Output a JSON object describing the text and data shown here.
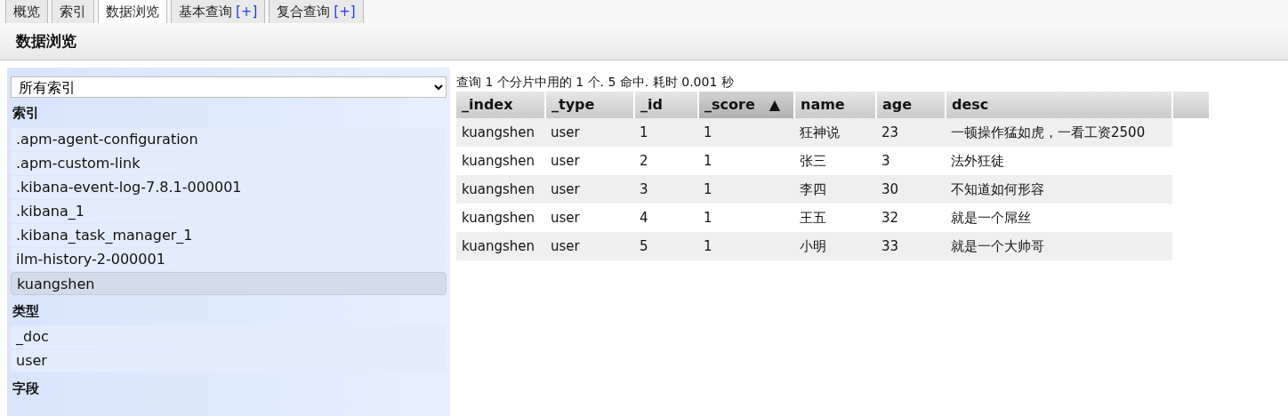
{
  "tabs": [
    {
      "label": "概览",
      "selected": false
    },
    {
      "label": "索引",
      "selected": false
    },
    {
      "label": "数据浏览",
      "selected": true
    },
    {
      "label": "基本查询",
      "plus": "[+]",
      "selected": false
    },
    {
      "label": "复合查询",
      "plus": "[+]",
      "selected": false
    }
  ],
  "page_title": "数据浏览",
  "sidebar": {
    "index_select": {
      "value": "所有索引"
    },
    "sections": [
      {
        "heading": "索引",
        "items": [
          {
            "label": ".apm-agent-configuration",
            "selected": false
          },
          {
            "label": ".apm-custom-link",
            "selected": false
          },
          {
            "label": ".kibana-event-log-7.8.1-000001",
            "selected": false
          },
          {
            "label": ".kibana_1",
            "selected": false
          },
          {
            "label": ".kibana_task_manager_1",
            "selected": false
          },
          {
            "label": "ilm-history-2-000001",
            "selected": false
          },
          {
            "label": "kuangshen",
            "selected": true
          }
        ]
      },
      {
        "heading": "类型",
        "items": [
          {
            "label": "_doc",
            "selected": false
          },
          {
            "label": "user",
            "selected": false
          }
        ]
      },
      {
        "heading": "字段"
      }
    ]
  },
  "results": {
    "summary": "查询 1 个分片中用的 1 个. 5 命中. 耗时 0.001 秒",
    "table": {
      "columns": [
        {
          "label": "_index",
          "sorted": false
        },
        {
          "label": "_type",
          "sorted": false
        },
        {
          "label": "_id",
          "sorted": false
        },
        {
          "label": "_score",
          "sorted": true,
          "sort_mark": "▲"
        },
        {
          "label": "name",
          "sorted": false
        },
        {
          "label": "age",
          "sorted": false
        },
        {
          "label": "desc",
          "sorted": false
        }
      ],
      "rows": [
        [
          "kuangshen",
          "user",
          "1",
          "1",
          "狂神说",
          "23",
          "一顿操作猛如虎，一看工资2500"
        ],
        [
          "kuangshen",
          "user",
          "2",
          "1",
          "张三",
          "3",
          "法外狂徒"
        ],
        [
          "kuangshen",
          "user",
          "3",
          "1",
          "李四",
          "30",
          "不知道如何形容"
        ],
        [
          "kuangshen",
          "user",
          "4",
          "1",
          "王五",
          "32",
          "就是一个屌丝"
        ],
        [
          "kuangshen",
          "user",
          "5",
          "1",
          "小明",
          "33",
          "就是一个大帅哥"
        ]
      ]
    }
  }
}
